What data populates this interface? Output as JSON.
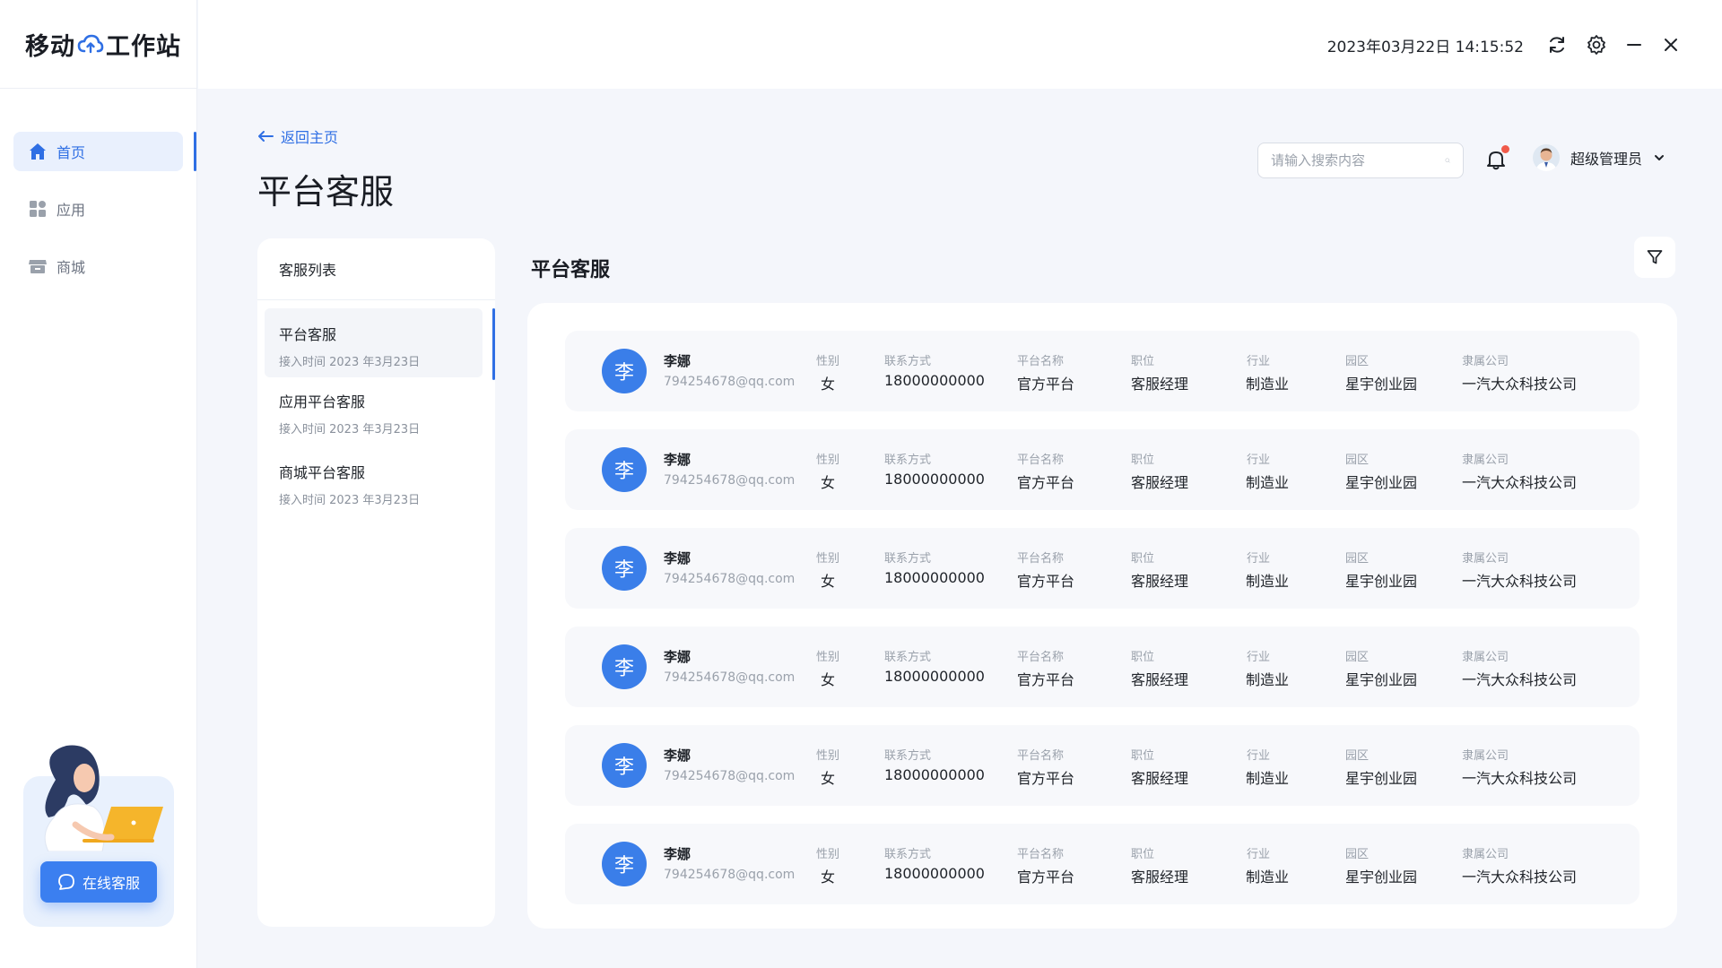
{
  "app": {
    "logo_left": "移动",
    "logo_right": "工作站"
  },
  "topbar": {
    "datetime": "2023年03月22日 14:15:52",
    "icons": [
      "refresh-icon",
      "gear-icon",
      "minimize-icon",
      "close-icon"
    ]
  },
  "sidebar": {
    "items": [
      {
        "label": "首页",
        "icon": "home-icon",
        "active": true
      },
      {
        "label": "应用",
        "icon": "apps-icon",
        "active": false
      },
      {
        "label": "商城",
        "icon": "store-icon",
        "active": false
      }
    ],
    "help_button": "在线客服"
  },
  "header": {
    "back_label": "返回主页",
    "page_title": "平台客服",
    "search_placeholder": "请输入搜索内容",
    "user_name": "超级管理员"
  },
  "list": {
    "title": "客服列表",
    "items": [
      {
        "title": "平台客服",
        "sub": "接入时间 2023 年3月23日",
        "active": true
      },
      {
        "title": "应用平台客服",
        "sub": "接入时间 2023 年3月23日",
        "active": false
      },
      {
        "title": "商城平台客服",
        "sub": "接入时间 2023 年3月23日",
        "active": false
      }
    ]
  },
  "content": {
    "title": "平台客服",
    "labels": {
      "gender": "性别",
      "contact": "联系方式",
      "platform": "平台名称",
      "position": "职位",
      "industry": "行业",
      "park": "园区",
      "company": "隶属公司"
    },
    "rows": [
      {
        "avatar": "李",
        "name": "李娜",
        "email": "794254678@qq.com",
        "gender": "女",
        "contact": "18000000000",
        "platform": "官方平台",
        "position": "客服经理",
        "industry": "制造业",
        "park": "星宇创业园",
        "company": "一汽大众科技公司"
      },
      {
        "avatar": "李",
        "name": "李娜",
        "email": "794254678@qq.com",
        "gender": "女",
        "contact": "18000000000",
        "platform": "官方平台",
        "position": "客服经理",
        "industry": "制造业",
        "park": "星宇创业园",
        "company": "一汽大众科技公司"
      },
      {
        "avatar": "李",
        "name": "李娜",
        "email": "794254678@qq.com",
        "gender": "女",
        "contact": "18000000000",
        "platform": "官方平台",
        "position": "客服经理",
        "industry": "制造业",
        "park": "星宇创业园",
        "company": "一汽大众科技公司"
      },
      {
        "avatar": "李",
        "name": "李娜",
        "email": "794254678@qq.com",
        "gender": "女",
        "contact": "18000000000",
        "platform": "官方平台",
        "position": "客服经理",
        "industry": "制造业",
        "park": "星宇创业园",
        "company": "一汽大众科技公司"
      },
      {
        "avatar": "李",
        "name": "李娜",
        "email": "794254678@qq.com",
        "gender": "女",
        "contact": "18000000000",
        "platform": "官方平台",
        "position": "客服经理",
        "industry": "制造业",
        "park": "星宇创业园",
        "company": "一汽大众科技公司"
      },
      {
        "avatar": "李",
        "name": "李娜",
        "email": "794254678@qq.com",
        "gender": "女",
        "contact": "18000000000",
        "platform": "官方平台",
        "position": "客服经理",
        "industry": "制造业",
        "park": "星宇创业园",
        "company": "一汽大众科技公司"
      }
    ]
  },
  "colors": {
    "accent": "#2f6fe4",
    "avatar_bg": "#3a7ee9",
    "notify_dot": "#f05a4a"
  }
}
